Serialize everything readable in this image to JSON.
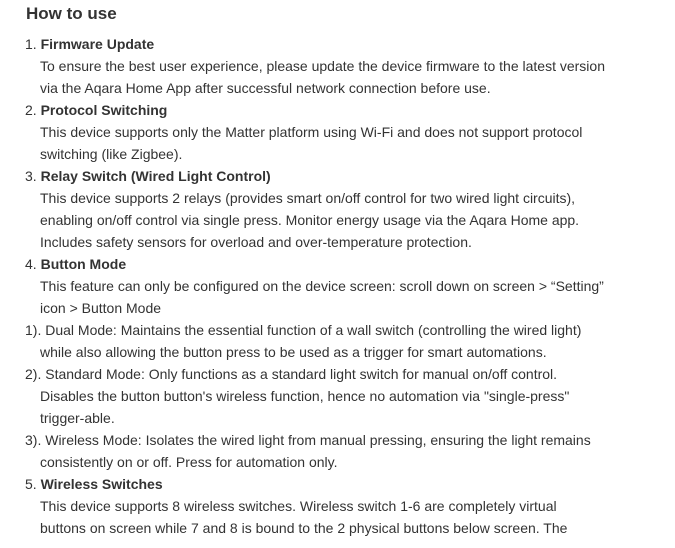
{
  "title": "How to use",
  "sections": [
    {
      "num": "1.",
      "heading": "Firmware Update",
      "lines": [
        "To ensure the best user experience, please update the device firmware to the latest version",
        "via the Aqara Home App after successful network connection before use."
      ]
    },
    {
      "num": "2.",
      "heading": "Protocol Switching",
      "lines": [
        "This device supports only the Matter platform using Wi-Fi and does not support protocol",
        "switching (like Zigbee)."
      ]
    },
    {
      "num": "3.",
      "heading": "Relay Switch (Wired Light Control)",
      "lines": [
        "This device supports 2 relays (provides smart on/off control for two wired light circuits),",
        "enabling on/off control via single press. Monitor energy usage via the Aqara Home app.",
        "Includes safety sensors for overload and over-temperature protection."
      ]
    },
    {
      "num": "4.",
      "heading": "Button Mode",
      "lines": [
        "This feature can only be configured on the device screen: scroll down on screen > “Setting”",
        "icon > Button Mode"
      ]
    },
    {
      "modes": [
        {
          "first": "1). Dual Mode: Maintains the essential function of a wall switch (controlling the wired light)",
          "cont": [
            "while also allowing the button press to be used as a trigger for smart automations."
          ]
        },
        {
          "first": "2). Standard Mode:  Only functions as a standard light switch for manual on/off control.",
          "cont": [
            "Disables the button button's wireless function, hence no automation via \"single-press\"",
            "trigger-able."
          ]
        },
        {
          "first": "3). Wireless Mode: Isolates the wired light from manual pressing, ensuring the light remains",
          "cont": [
            "consistently on or off. Press for automation only."
          ]
        }
      ]
    },
    {
      "num": "5.",
      "heading": "Wireless Switches",
      "lines": [
        "This device supports 8 wireless switches.  Wireless switch 1-6 are completely virtual",
        "buttons on screen while 7 and 8 is bound to the 2 physical buttons below screen. The"
      ]
    }
  ]
}
